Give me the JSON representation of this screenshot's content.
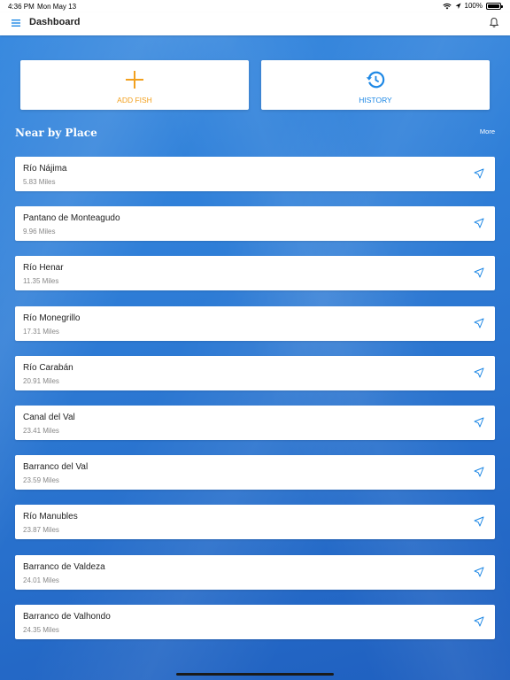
{
  "status_bar": {
    "time": "4:36 PM",
    "date": "Mon May 13",
    "battery_text": "100%"
  },
  "nav": {
    "title": "Dashboard",
    "menu_icon": "hamburger-menu-icon",
    "notification_icon": "bell-icon"
  },
  "actions": {
    "add_fish": {
      "label": "ADD FISH",
      "icon": "plus-icon",
      "color": "#f2a01e"
    },
    "history": {
      "label": "HISTORY",
      "icon": "history-clock-icon",
      "color": "#1e88e5"
    }
  },
  "nearby": {
    "title": "Near by Place",
    "more_label": "More",
    "places": [
      {
        "name": "Río Nájima",
        "distance": "5.83 Miles"
      },
      {
        "name": "Pantano de Monteagudo",
        "distance": "9.96 Miles"
      },
      {
        "name": "Río Henar",
        "distance": "11.35 Miles"
      },
      {
        "name": "Río Monegrillo",
        "distance": "17.31 Miles"
      },
      {
        "name": "Río Carabán",
        "distance": "20.91 Miles"
      },
      {
        "name": "Canal del Val",
        "distance": "23.41 Miles"
      },
      {
        "name": "Barranco del Val",
        "distance": "23.59 Miles"
      },
      {
        "name": "Río Manubles",
        "distance": "23.87 Miles"
      },
      {
        "name": "Barranco de Valdeza",
        "distance": "24.01 Miles"
      },
      {
        "name": "Barranco de Valhondo",
        "distance": "24.35 Miles"
      }
    ]
  },
  "colors": {
    "accent_blue": "#1e88e5",
    "accent_orange": "#f2a01e",
    "background_blue": "#2f7fd8"
  }
}
